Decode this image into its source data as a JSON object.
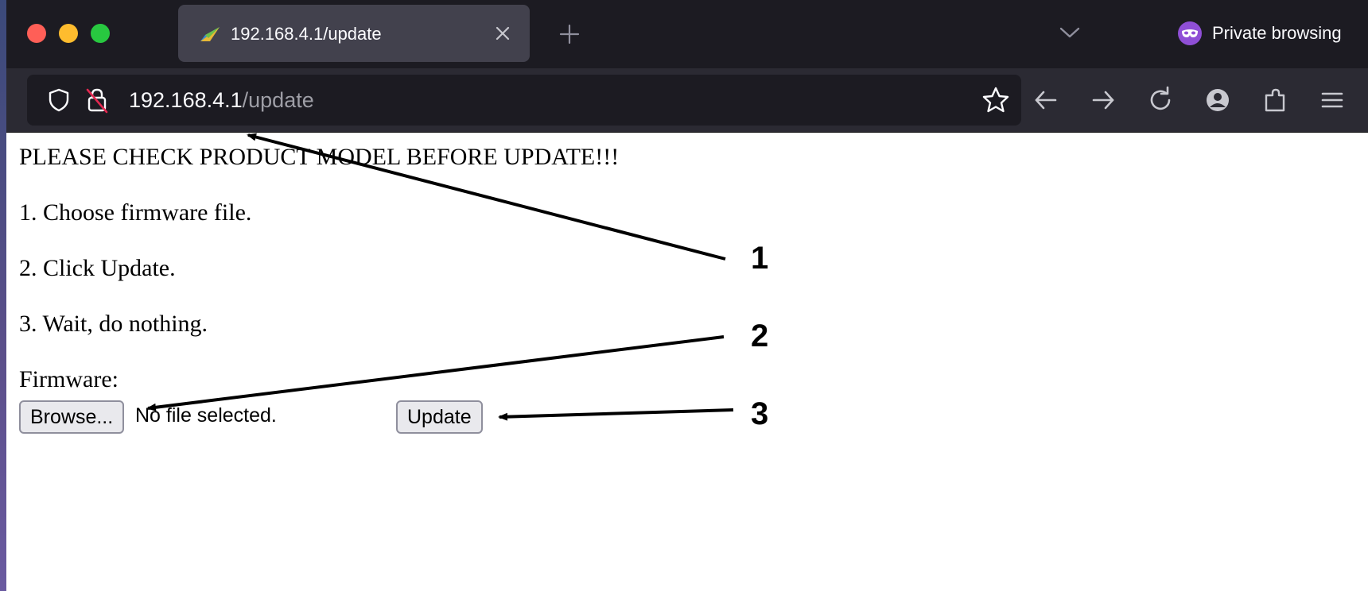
{
  "browser": {
    "tab": {
      "title": "192.168.4.1/update",
      "favicon": "paper-plane-icon"
    },
    "private_label": "Private browsing",
    "url": {
      "host": "192.168.4.1",
      "path": "/update"
    },
    "colors": {
      "titlebar": "#1c1b22",
      "toolbar": "#2b2a33",
      "tab_active": "#42414d",
      "private_accent": "#8f4fd6"
    }
  },
  "page": {
    "warning": "PLEASE CHECK PRODUCT MODEL BEFORE UPDATE!!!",
    "steps": [
      "1. Choose firmware file.",
      "2. Click Update.",
      "3. Wait, do nothing."
    ],
    "firmware_label": "Firmware:",
    "browse_label": "Browse...",
    "file_status": "No file selected.",
    "update_label": "Update"
  },
  "annotations": {
    "callouts": [
      "1",
      "2",
      "3"
    ]
  }
}
